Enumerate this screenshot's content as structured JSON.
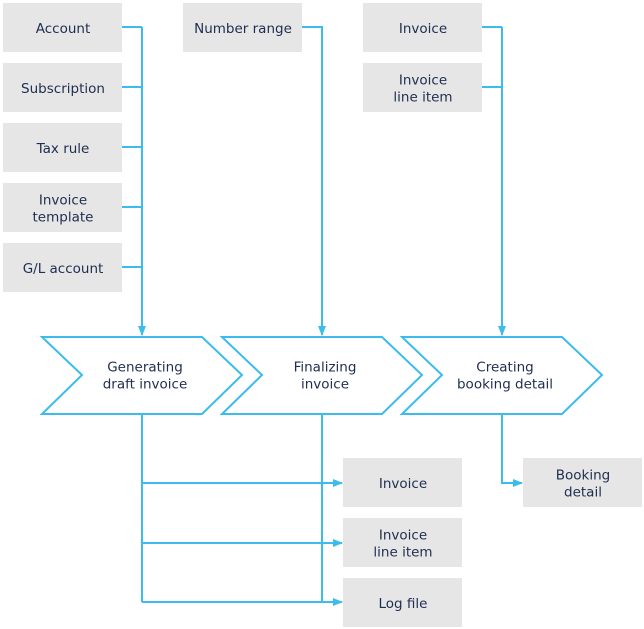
{
  "colors": {
    "line": "#3bbcec",
    "box": "#e6e6e6",
    "text": "#1f2d4f"
  },
  "inputs_left": [
    [
      "Account"
    ],
    [
      "Subscription"
    ],
    [
      "Tax rule"
    ],
    [
      "Invoice",
      "template"
    ],
    [
      "G/L account"
    ]
  ],
  "inputs_mid": [
    [
      "Number range"
    ]
  ],
  "inputs_right": [
    [
      "Invoice"
    ],
    [
      "Invoice",
      "line item"
    ]
  ],
  "steps": [
    [
      "Generating",
      "draft invoice"
    ],
    [
      "Finalizing",
      "invoice"
    ],
    [
      "Creating",
      "booking detail"
    ]
  ],
  "outputs_mid": [
    [
      "Invoice"
    ],
    [
      "Invoice",
      "line item"
    ],
    [
      "Log file"
    ]
  ],
  "outputs_right": [
    [
      "Booking",
      "detail"
    ]
  ]
}
